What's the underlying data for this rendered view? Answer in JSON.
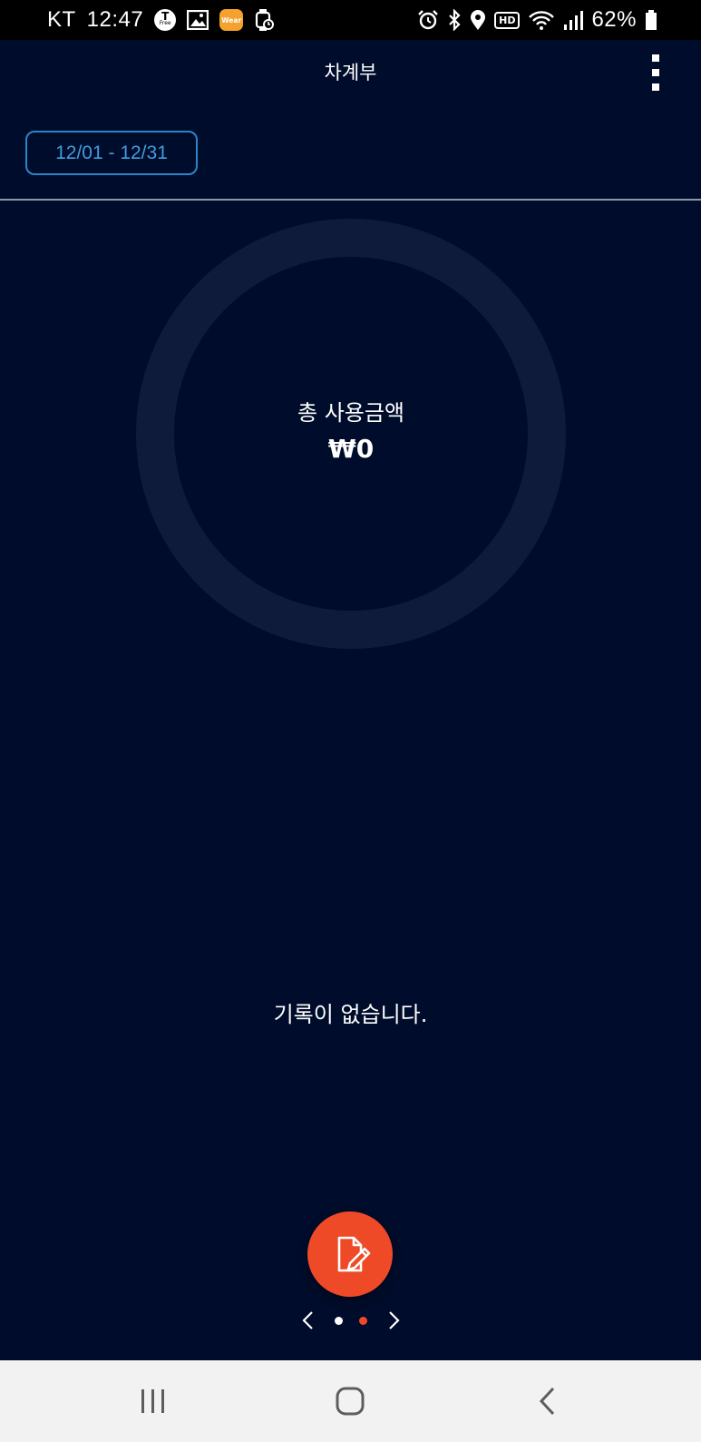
{
  "status_bar": {
    "carrier": "KT",
    "time": "12:47",
    "tmap_label": "T",
    "tmap_sub": "Free",
    "wear_label": "Wear",
    "hd_label": "HD",
    "battery": "62%"
  },
  "app_bar": {
    "title": "차계부"
  },
  "filter": {
    "date_range": "12/01 - 12/31"
  },
  "summary": {
    "label": "총 사용금액",
    "amount": "₩0"
  },
  "empty_state": {
    "message": "기록이 없습니다."
  },
  "pager": {
    "active_index": 1,
    "count": 2
  },
  "colors": {
    "background": "#000c2b",
    "accent": "#ef4a27",
    "date_border": "#2a86c9",
    "donut_track": "#0e1b3a",
    "nav_bar": "#f2f2f2"
  },
  "icons": {
    "fab": "edit-document-icon",
    "menu": "more-vert-icon",
    "nav_recent": "recent-apps-icon",
    "nav_home": "home-icon",
    "nav_back": "back-icon"
  }
}
